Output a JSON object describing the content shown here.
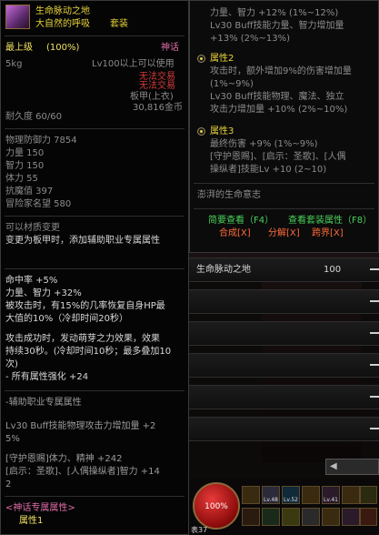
{
  "item": {
    "name": "生命脉动之地",
    "set_name": "大自然的呼吸",
    "set_tag": "套装",
    "grade": "最上级",
    "grade_pct": "(100%)",
    "rarity": "神话",
    "weight": "5kg",
    "level_req": "Lv100以上可以使用",
    "trade_note_1": "无法交易",
    "trade_note_2": "无法交易",
    "slot": "板甲(上衣)",
    "price": "30,816金币",
    "durability": "耐久度 60/60",
    "stats": [
      "物理防御力 7854",
      "力量 150",
      "智力 150",
      "体力 55",
      "抗魔值 397",
      "冒险家名望 580"
    ],
    "convert_1": "可以材质变更",
    "convert_2": "变更为板甲时，添加辅助职业专属属性",
    "effects": [
      "命中率 +5%",
      "力量、智力 +32%",
      "被攻击时，有15%的几率恢复自身HP最",
      "大值的10%（冷却时间20秒）"
    ],
    "effects2": [
      "攻击成功时，发动萌芽之力效果，效果",
      "持续30秒。(冷却时间10秒；最多叠加10",
      "次)",
      "- 所有属性强化 +24"
    ],
    "support_header": "-辅助职业专属属性",
    "support_lines": [
      "Lv30 Buff技能物理攻击力增加量 +2",
      "5%"
    ],
    "support_lines2": [
      "[守护恩赐]体力、精神 +242",
      "[启示：圣歌]、[人偶操纵者]智力 +14",
      "2"
    ],
    "myth_header": "<神话专属属性>",
    "myth_attr": "属性1"
  },
  "right_tooltip": {
    "top_lines": [
      "力量、智力 +12% (1%~12%)",
      "Lv30 Buff技能力量、智力增加量",
      "+13% (2%~13%)"
    ],
    "attr2_title": "属性2",
    "attr2_lines": [
      "攻击时，额外增加9%的伤害增加量",
      "(1%~9%)",
      "Lv30 Buff技能物理、魔法、独立",
      "攻击力增加量 +10% (2%~10%)"
    ],
    "attr3_title": "属性3",
    "attr3_lines": [
      "最终伤害 +9% (1%~9%)",
      "[守护恩赐]、[启示：圣歌]、[人偶",
      "操纵者]技能Lv +10 (2~10)"
    ],
    "flavor": "澎湃的生命意志",
    "brief_view": "简要查看（F4）",
    "set_view": "查看套装属性（F8）",
    "synth": "合成[X]",
    "decompose": "分解[X]",
    "cross": "跨界[X]"
  },
  "game": {
    "buff_label": "生命脉动之地",
    "buff_value": "100",
    "hp_pct": "100%",
    "skill_levels": [
      "Lv.48",
      "Lv.52",
      "Lv.41"
    ],
    "bottom_label": "表37"
  },
  "colors": {
    "gold": "#e8d23a",
    "pink": "#e06da8",
    "green": "#4ad25a",
    "orange": "#ff6a3a"
  }
}
